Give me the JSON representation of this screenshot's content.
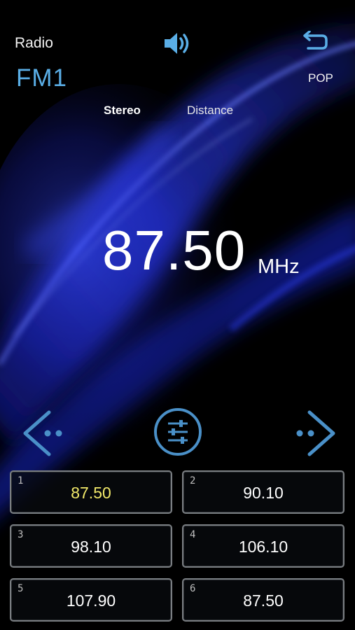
{
  "header": {
    "app_title": "Radio",
    "band": "FM1",
    "eq_mode": "POP",
    "stereo_label": "Stereo",
    "distance_label": "Distance"
  },
  "tuner": {
    "frequency": "87.50",
    "unit": "MHz"
  },
  "icons": {
    "volume": "speaker-icon",
    "back": "back-arrow-icon",
    "prev": "seek-prev-icon",
    "next": "seek-next-icon",
    "equalizer": "equalizer-icon"
  },
  "presets": [
    {
      "num": "1",
      "freq": "87.50",
      "active": true
    },
    {
      "num": "2",
      "freq": "90.10",
      "active": false
    },
    {
      "num": "3",
      "freq": "98.10",
      "active": false
    },
    {
      "num": "4",
      "freq": "106.10",
      "active": false
    },
    {
      "num": "5",
      "freq": "107.90",
      "active": false
    },
    {
      "num": "6",
      "freq": "87.50",
      "active": false
    }
  ],
  "colors": {
    "accent": "#5aaee6",
    "active_preset": "#f2e96a",
    "background": "#000000"
  }
}
